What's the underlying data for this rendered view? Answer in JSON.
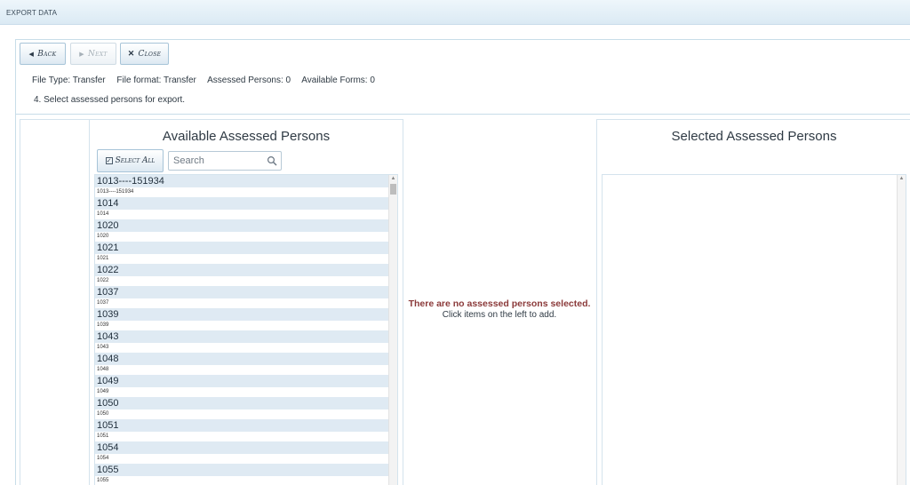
{
  "window": {
    "title": "EXPORT DATA"
  },
  "toolbar": {
    "back_label": "Back",
    "next_label": "Next",
    "close_label": "Close"
  },
  "info": {
    "file_type": "File Type: Transfer",
    "file_format": "File format: Transfer",
    "assessed_persons": "Assessed Persons: 0",
    "available_forms": "Available Forms: 0",
    "step": "4. Select assessed persons for export."
  },
  "available": {
    "title": "Available Assessed Persons",
    "select_all_label": "Select All",
    "search_placeholder": "Search",
    "items": [
      {
        "main": "1013----151934",
        "sub": "1013----151934"
      },
      {
        "main": "1014",
        "sub": "1014"
      },
      {
        "main": "1020",
        "sub": "1020"
      },
      {
        "main": "1021",
        "sub": "1021"
      },
      {
        "main": "1022",
        "sub": "1022"
      },
      {
        "main": "1037",
        "sub": "1037"
      },
      {
        "main": "1039",
        "sub": "1039"
      },
      {
        "main": "1043",
        "sub": "1043"
      },
      {
        "main": "1048",
        "sub": "1048"
      },
      {
        "main": "1049",
        "sub": "1049"
      },
      {
        "main": "1050",
        "sub": "1050"
      },
      {
        "main": "1051",
        "sub": "1051"
      },
      {
        "main": "1054",
        "sub": "1054"
      },
      {
        "main": "1055",
        "sub": "1055"
      }
    ]
  },
  "middle": {
    "warning": "There are no assessed persons selected.",
    "hint": "Click items on the left to add."
  },
  "selected": {
    "title": "Selected Assessed Persons"
  },
  "colors": {
    "accent_row": "#dfeaf3",
    "warning": "#8b3a3a",
    "border": "#d4e3ed"
  }
}
